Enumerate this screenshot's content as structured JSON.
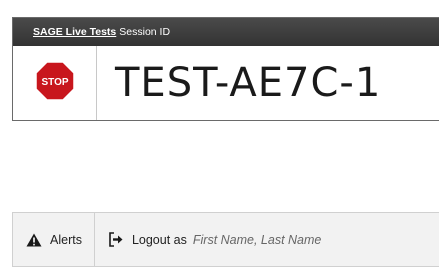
{
  "session": {
    "header_link": "SAGE Live Tests",
    "header_label": "Session ID",
    "stop_icon_text": "STOP",
    "session_id": "TEST-AE7C-1"
  },
  "toolbar": {
    "alerts_label": "Alerts",
    "logout_label": "Logout as",
    "logout_name_placeholder": "First Name, Last Name"
  },
  "colors": {
    "header_bg": "#3c3c3c",
    "stop_red": "#c8161d",
    "toolbar_bg": "#f2f2f2"
  },
  "icons": {
    "stop": "stop-sign-icon",
    "alerts": "warning-icon",
    "logout": "logout-icon"
  }
}
